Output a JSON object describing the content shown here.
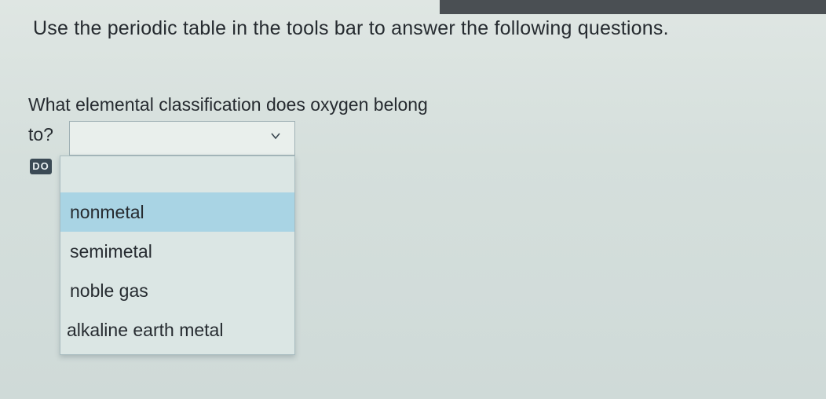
{
  "instructions": "Use the periodic table in the tools bar to answer the following questions.",
  "question": {
    "line1": "What elemental classification does oxygen belong",
    "line2": "to?"
  },
  "badge": "DO",
  "dropdown": {
    "selected_value": "",
    "options": [
      {
        "label": "nonmetal",
        "highlighted": true
      },
      {
        "label": "semimetal",
        "highlighted": false
      },
      {
        "label": "noble gas",
        "highlighted": false
      },
      {
        "label": "alkaline earth metal",
        "highlighted": false
      }
    ],
    "highlight_color": "#a9d4e4"
  },
  "icons": {
    "select_arrow": "chevron-down-icon"
  }
}
